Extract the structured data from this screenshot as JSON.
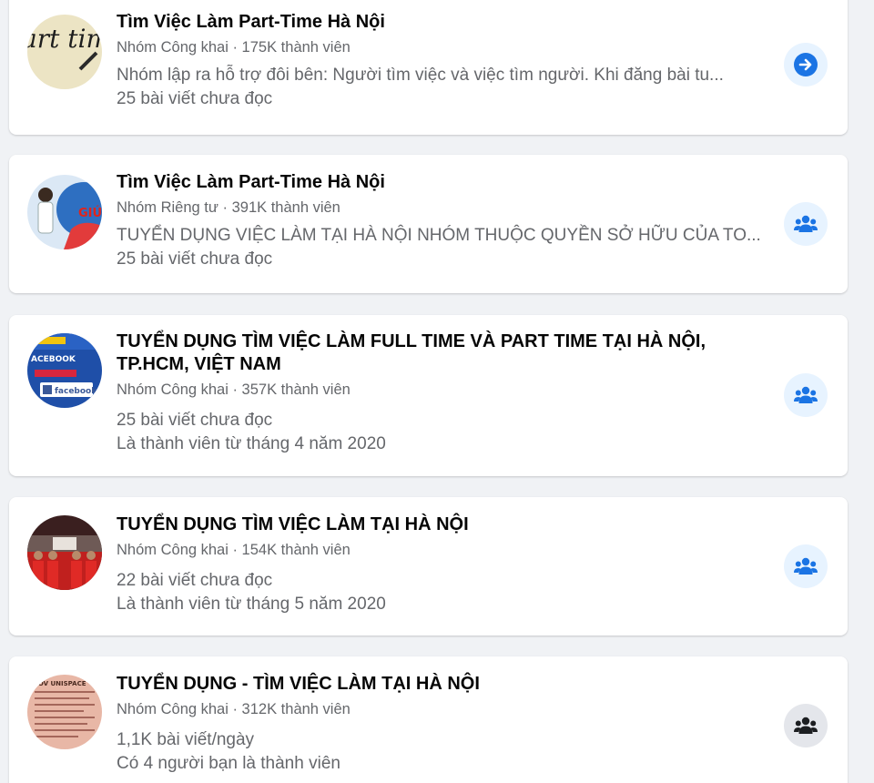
{
  "colors": {
    "background": "#f0f2f5",
    "card": "#ffffff",
    "accent": "#1b74e4",
    "action_bg_blue": "#e7f3ff",
    "action_bg_gray": "#e4e6eb",
    "secondary_text": "#65676b"
  },
  "groups": [
    {
      "name": "Tìm Việc Làm Part-Time Hà Nội",
      "meta": "Nhóm Công khai · 175K thành viên",
      "description": "Nhóm lập ra hỗ trợ đôi bên: Người tìm việc và việc tìm người. Khi đăng bài tu...",
      "posts": "25 bài viết chưa đọc",
      "avatar_text": "art time job",
      "action_icon": "arrow-right-icon"
    },
    {
      "name": "Tìm Việc Làm Part-Time Hà Nội",
      "meta": "Nhóm Riêng tư · 391K thành viên",
      "description": "TUYỂN DỤNG VIỆC LÀM TẠI HÀ NỘI NHÓM THUỘC QUYỀN SỞ HỮU CỦA TO...",
      "posts": "25 bài viết chưa đọc",
      "avatar_text": "GIÚ",
      "action_icon": "group-icon"
    },
    {
      "name": "TUYỂN DỤNG TÌM VIỆC LÀM FULL TIME VÀ PART TIME TẠI HÀ NỘI, TP.HCM, VIỆT NAM",
      "meta": "Nhóm Công khai · 357K thành viên",
      "posts": "25 bài viết chưa đọc",
      "membership": "Là thành viên từ tháng 4 năm 2020",
      "avatar_text": "ACEBOOK",
      "avatar_text_2": "facebook",
      "action_icon": "group-icon"
    },
    {
      "name": "TUYỂN DỤNG TÌM VIỆC LÀM TẠI HÀ NỘI",
      "meta": "Nhóm Công khai · 154K thành viên",
      "posts": "22 bài viết chưa đọc",
      "membership": "Là thành viên từ tháng 5 năm 2020",
      "action_icon": "group-icon"
    },
    {
      "name": "TUYỂN DỤNG - TÌM VIỆC LÀM TẠI HÀ NỘI",
      "meta": "Nhóm Công khai · 312K thành viên",
      "posts": "1,1K bài viết/ngày",
      "friends": "Có 4 người bạn là thành viên",
      "avatar_text": "HOV UNISPACE",
      "action_icon": "group-icon"
    }
  ]
}
